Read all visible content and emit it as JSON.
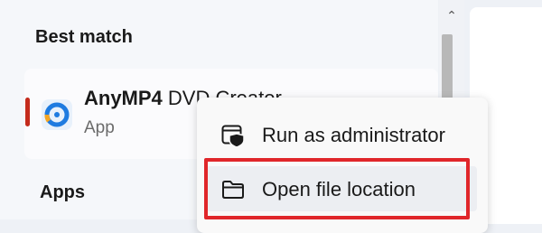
{
  "search_results": {
    "best_match_heading": "Best match",
    "best_match": {
      "app_name_bold": "AnyMP4",
      "app_name_rest": " DVD Creator",
      "app_type": "App",
      "icon": "anymp4-dvd-creator-icon"
    },
    "apps_heading": "Apps"
  },
  "context_menu": {
    "items": [
      {
        "label": "Run as administrator",
        "icon": "shield-window-icon"
      },
      {
        "label": "Open file location",
        "icon": "folder-icon"
      }
    ]
  },
  "scrollbar": {
    "up_arrow": "⌃"
  },
  "colors": {
    "accent_red": "#e0262a",
    "selection_indicator": "#c42b1c",
    "app_icon_blue": "#1e7be0",
    "app_icon_orange": "#f5a623"
  }
}
